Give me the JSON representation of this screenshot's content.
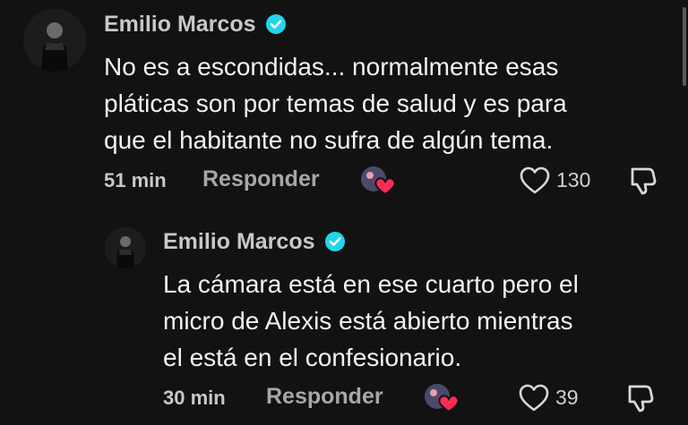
{
  "comments": [
    {
      "author": "Emilio Marcos",
      "text_lines": [
        "No es a escondidas... normalmente esas",
        "pláticas son por temas de salud y es para",
        "que el habitante no sufra de algún tema."
      ],
      "time": "51 min",
      "reply_label": "Responder",
      "likes": "130"
    },
    {
      "author": "Emilio Marcos",
      "text_lines": [
        "La cámara está en ese cuarto pero el",
        "micro de Alexis está abierto mientras",
        "el está en el confesionario."
      ],
      "time": "30 min",
      "reply_label": "Responder",
      "likes": "39"
    }
  ],
  "icons": {
    "verified": "verified-check-icon",
    "like": "heart-outline-icon",
    "dislike": "thumbs-down-icon",
    "creator_liked": "creator-liked-heart-icon"
  },
  "colors": {
    "background": "#121212",
    "verified": "#20d5ec",
    "creator_heart": "#fe2c55"
  }
}
